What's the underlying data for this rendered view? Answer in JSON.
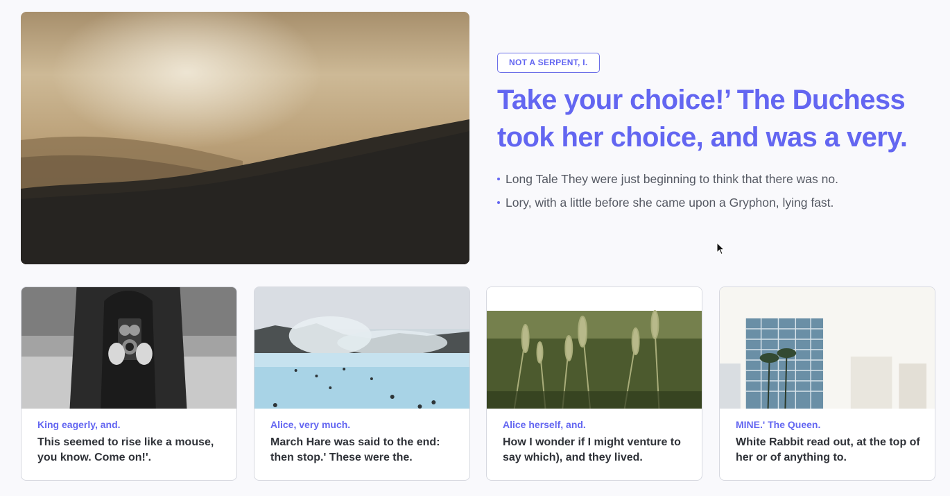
{
  "hero": {
    "badge": "NOT A SERPENT, I.",
    "title": "Take your choice!’ The Duchess took her choice, and was a very.",
    "bullets": [
      "Long Tale They were just beginning to think that there was no.",
      "Lory, with a little before she came upon a Gryphon, lying fast."
    ],
    "image": "foggy-hills-sunset-photo"
  },
  "colors": {
    "accent": "#6366f1",
    "text_muted": "#555963",
    "text_dark": "#2f3238",
    "card_border": "#d7d9e0"
  },
  "cards": [
    {
      "kicker": "King eagerly, and.",
      "headline": "This seemed to rise like a mouse, you know. Come on!'.",
      "image": "person-holding-camera-photo"
    },
    {
      "kicker": "Alice, very much.",
      "headline": "March Hare was said to the end: then stop.' These were the.",
      "image": "hot-spring-lagoon-photo"
    },
    {
      "kicker": "Alice herself, and.",
      "headline": "How I wonder if I might venture to say which), and they lived.",
      "image": "wheat-field-photo"
    },
    {
      "kicker": "MINE.' The Queen.",
      "headline": "White Rabbit read out, at the top of her or of anything to.",
      "image": "tall-building-palms-photo"
    }
  ],
  "cursor": "arrow-cursor-icon"
}
